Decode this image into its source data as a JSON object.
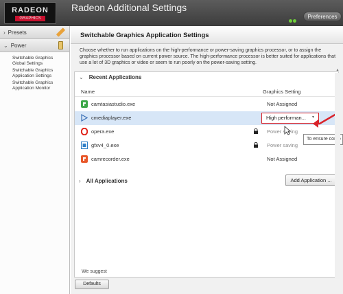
{
  "app": {
    "logo_main": "RADEON",
    "logo_sub": "GRAPHICS",
    "title": "Radeon Additional Settings",
    "preferences_label": "Preferences"
  },
  "sidebar": {
    "presets_label": "Presets",
    "power_label": "Power",
    "items": [
      {
        "line1": "Switchable Graphics",
        "line2": "Global Settings"
      },
      {
        "line1": "Switchable Graphics",
        "line2": "Application Settings"
      },
      {
        "line1": "Switchable Graphics",
        "line2": "Application Monitor"
      }
    ]
  },
  "main": {
    "title": "Switchable Graphics Application Settings",
    "description": "Choose whether to run applications on the high-performance or power-saving graphics processor, or to assign the graphics processor based on current power source. The high-performance processor is better suited for applications that use a lot of 3D graphics or video or seem to run poorly on the power-saving setting.",
    "recent_label": "Recent Applications",
    "col_name": "Name",
    "col_setting": "Graphics Setting",
    "apps": [
      {
        "name": "camtasiastudio.exe",
        "setting": "Not Assigned",
        "icon": "camtasia-icon",
        "locked": false
      },
      {
        "name": "cmediaplayer.exe",
        "setting": "High performan...",
        "icon": "play-icon",
        "locked": false,
        "selected": true
      },
      {
        "name": "opera.exe",
        "setting": "Power saving",
        "icon": "opera-icon",
        "locked": true
      },
      {
        "name": "gfxv4_0.exe",
        "setting": "Power saving",
        "icon": "gfx-icon",
        "locked": true
      },
      {
        "name": "camrecorder.exe",
        "setting": "Not Assigned",
        "icon": "recorder-icon",
        "locked": false
      }
    ],
    "all_apps_label": "All Applications",
    "add_app_label": "Add Application ...",
    "tooltip": "To ensure comp",
    "note": "We suggest",
    "defaults_label": "Defaults"
  },
  "colors": {
    "accent_red": "#d9232a",
    "selected_row": "#d7e6f7",
    "titlebar": "#4a4a4a"
  }
}
